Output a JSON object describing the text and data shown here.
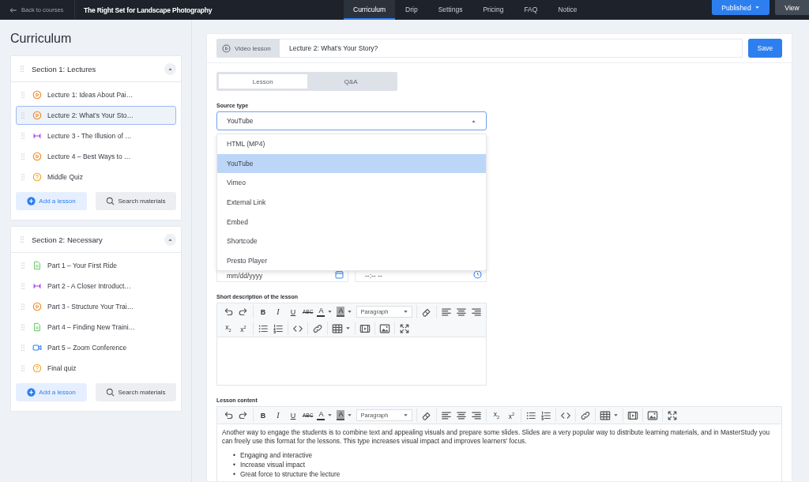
{
  "top_bar": {
    "back_link": "Back to courses",
    "course_title": "The Right Set for Landscape Photography",
    "tabs": [
      {
        "label": "Curriculum",
        "selected": true
      },
      {
        "label": "Drip",
        "selected": false
      },
      {
        "label": "Settings",
        "selected": false
      },
      {
        "label": "Pricing",
        "selected": false
      },
      {
        "label": "FAQ",
        "selected": false
      },
      {
        "label": "Notice",
        "selected": false
      }
    ],
    "publish_button": "Published",
    "view_button": "View"
  },
  "sidebar": {
    "title": "Curriculum",
    "sections": [
      {
        "title": "Section 1: Lectures",
        "expanded": true,
        "add_button": "Add a lesson",
        "search_button": "Search materials",
        "lessons": [
          {
            "title": "Lecture 1: Ideas About Pai…",
            "kind": "video",
            "selected": false
          },
          {
            "title": "Lecture 2: What’s Your Sto…",
            "kind": "video",
            "selected": true
          },
          {
            "title": "Lecture 3 - The Illusion of …",
            "kind": "stream",
            "selected": false
          },
          {
            "title": "Lecture 4 – Best Ways to …",
            "kind": "video",
            "selected": false
          },
          {
            "title": "Middle Quiz",
            "kind": "quiz",
            "selected": false
          }
        ]
      },
      {
        "title": "Section 2: Necessary",
        "expanded": true,
        "add_button": "Add a lesson",
        "search_button": "Search materials",
        "lessons": [
          {
            "title": "Part 1 – Your First Ride",
            "kind": "text",
            "selected": false
          },
          {
            "title": "Part 2 - A Closer Introduct…",
            "kind": "stream",
            "selected": false
          },
          {
            "title": "Part 3 - Structure Your Trai…",
            "kind": "video",
            "selected": false
          },
          {
            "title": "Part 4 – Finding New Traini…",
            "kind": "text",
            "selected": false
          },
          {
            "title": "Part 5 – Zoom Conference",
            "kind": "zoom",
            "selected": false
          },
          {
            "title": "Final quiz",
            "kind": "quiz",
            "selected": false
          }
        ]
      }
    ]
  },
  "lesson": {
    "type_label": "Video lesson",
    "title": "Lecture 2: What’s Your Story?",
    "save_button": "Save",
    "tabs": [
      {
        "label": "Lesson",
        "selected": true
      },
      {
        "label": "Q&A",
        "selected": false
      }
    ],
    "source_type": {
      "label": "Source type",
      "value": "YouTube",
      "expanded": true,
      "options": [
        {
          "label": "HTML (MP4)",
          "selected": false
        },
        {
          "label": "YouTube",
          "selected": true
        },
        {
          "label": "Vimeo",
          "selected": false
        },
        {
          "label": "External Link",
          "selected": false
        },
        {
          "label": "Embed",
          "selected": false
        },
        {
          "label": "Shortcode",
          "selected": false
        },
        {
          "label": "Presto Player",
          "selected": false
        }
      ]
    },
    "date_field": {
      "placeholder": "mm/dd/yyyy"
    },
    "time_field": {
      "placeholder": "--:-- --"
    },
    "short_description": {
      "label": "Short description of the lesson",
      "toolbar_rows": [
        [
          [
            {
              "kind": "undo"
            },
            {
              "kind": "redo"
            }
          ],
          [
            {
              "kind": "bold",
              "label": "B"
            },
            {
              "kind": "italic",
              "label": "I"
            },
            {
              "kind": "underline",
              "label": "U"
            },
            {
              "kind": "strike",
              "label": "ABC"
            },
            {
              "kind": "color",
              "label": "A"
            },
            {
              "kind": "highlight",
              "label": "A"
            },
            {
              "kind": "select",
              "label": "Paragraph"
            }
          ],
          [
            {
              "kind": "eraser"
            }
          ],
          [
            {
              "kind": "align-left"
            },
            {
              "kind": "align-center"
            },
            {
              "kind": "align-right"
            }
          ]
        ],
        [
          [
            {
              "kind": "sub",
              "label": "x$_{2}$"
            },
            {
              "kind": "sup",
              "label": "x$^{2}$"
            }
          ],
          [
            {
              "kind": "ul"
            },
            {
              "kind": "ol"
            }
          ],
          [
            {
              "kind": "code"
            }
          ],
          [
            {
              "kind": "link"
            }
          ],
          [
            {
              "kind": "table"
            }
          ],
          [
            {
              "kind": "media"
            }
          ],
          [
            {
              "kind": "image"
            }
          ],
          [
            {
              "kind": "fullscreen"
            }
          ]
        ]
      ]
    },
    "content": {
      "label": "Lesson content",
      "toolbar_rows": [
        [
          [
            {
              "kind": "undo"
            },
            {
              "kind": "redo"
            }
          ],
          [
            {
              "kind": "bold",
              "label": "B"
            },
            {
              "kind": "italic",
              "label": "I"
            },
            {
              "kind": "underline",
              "label": "U"
            },
            {
              "kind": "strike",
              "label": "ABC"
            },
            {
              "kind": "color",
              "label": "A"
            },
            {
              "kind": "highlight",
              "label": "A"
            },
            {
              "kind": "select",
              "label": "Paragraph"
            }
          ],
          [
            {
              "kind": "eraser"
            }
          ],
          [
            {
              "kind": "align-left"
            },
            {
              "kind": "align-center"
            },
            {
              "kind": "align-right"
            }
          ],
          [
            {
              "kind": "sub",
              "label": "x$_{2}$"
            },
            {
              "kind": "sup",
              "label": "x$^{2}$"
            }
          ],
          [
            {
              "kind": "ul"
            },
            {
              "kind": "ol"
            }
          ],
          [
            {
              "kind": "code"
            }
          ],
          [
            {
              "kind": "link"
            }
          ],
          [
            {
              "kind": "table"
            }
          ],
          [
            {
              "kind": "media"
            }
          ],
          [
            {
              "kind": "image"
            }
          ],
          [
            {
              "kind": "fullscreen"
            }
          ]
        ]
      ],
      "paragraph": "Another way to engage the students is to combine text and appealing visuals and prepare some slides. Slides are a very popular way to distribute learning materials, and in MasterStudy you can freely use this format for the lessons. This type increases visual impact and improves learners' focus.",
      "bullet_marker": "•",
      "bullets": [
        "Engaging and interactive",
        "Increase visual impact",
        "Great force to structure the lecture"
      ]
    }
  }
}
